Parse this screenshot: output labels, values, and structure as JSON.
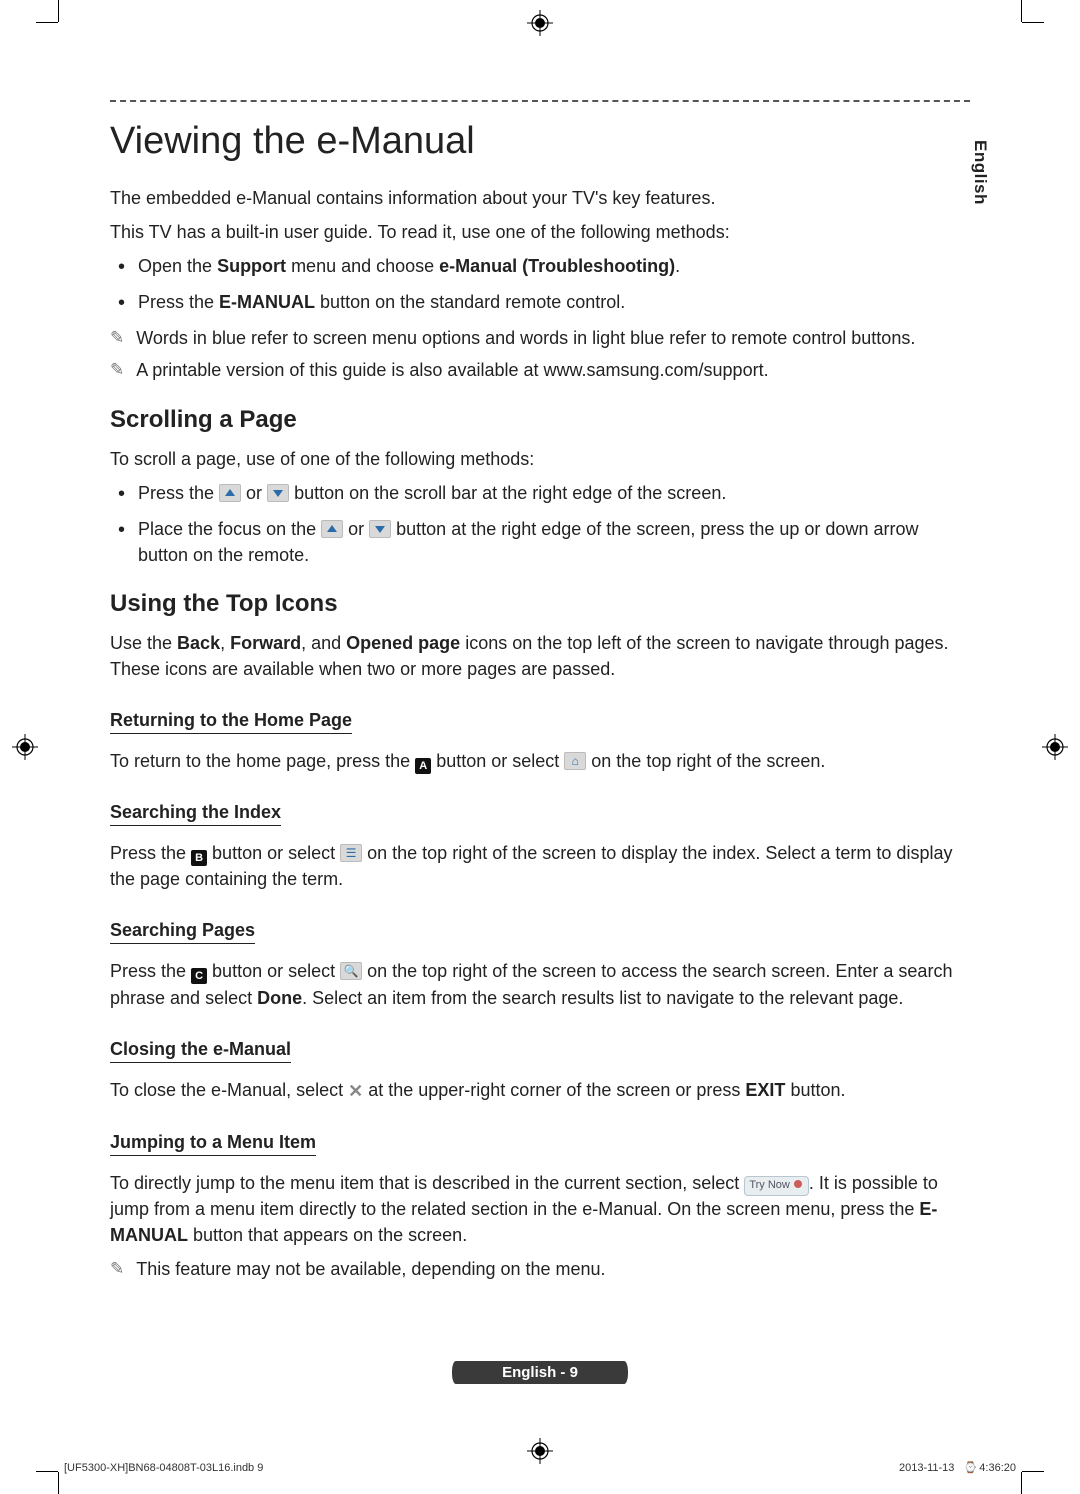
{
  "sideTab": "English",
  "title": "Viewing the e-Manual",
  "intro": {
    "p1": "The embedded e-Manual contains information about your TV's key features.",
    "p2": "This TV has a built-in user guide. To read it, use one of the following methods:",
    "bul1_pre": "Open the ",
    "bul1_b1": "Support",
    "bul1_mid": " menu and choose ",
    "bul1_b2": "e-Manual (Troubleshooting)",
    "bul1_post": ".",
    "bul2_pre": "Press the ",
    "bul2_b": "E-MANUAL",
    "bul2_post": " button on the standard remote control.",
    "note1": "Words in blue refer to screen menu options and words in light blue refer to remote control buttons.",
    "note2": "A printable version of this guide is also available at www.samsung.com/support."
  },
  "scroll": {
    "h": "Scrolling a Page",
    "p": "To scroll a page, use of one of the following methods:",
    "b1_a": "Press the ",
    "b1_b": " or ",
    "b1_c": " button on the scroll bar at the right edge of the screen.",
    "b2_a": "Place the focus on the ",
    "b2_b": " or ",
    "b2_c": " button at the right edge of the screen, press the up or down arrow button on the remote."
  },
  "topicons": {
    "h": "Using the Top Icons",
    "p_a": "Use the ",
    "p_b1": "Back",
    "p_m1": ", ",
    "p_b2": "Forward",
    "p_m2": ", and ",
    "p_b3": "Opened page",
    "p_c": " icons on the top left of the screen to navigate through pages. These icons are available when two or more pages are passed.",
    "home_h": "Returning to the Home Page",
    "home_a": "To return to the home page, press the ",
    "home_b": " button or select ",
    "home_c": " on the top right of the screen.",
    "btnA": "A",
    "index_h": "Searching the Index",
    "index_a": "Press the ",
    "index_b": " button or select ",
    "index_c": " on the top right of the screen to display the index. Select a term to display the page containing the term.",
    "btnB": "B",
    "pages_h": "Searching Pages",
    "pages_a": "Press the ",
    "pages_b": " button or select ",
    "pages_c": " on the top right of the screen to access the search screen. Enter a search phrase and select ",
    "pages_d": "Done",
    "pages_e": ". Select an item from the search results list to navigate to the relevant page.",
    "btnC": "C",
    "close_h": "Closing the e-Manual",
    "close_a": "To close the e-Manual, select ",
    "close_b": " at the upper-right corner of the screen or press ",
    "close_c": "EXIT",
    "close_d": " button.",
    "jump_h": "Jumping to a Menu Item",
    "jump_a": "To directly jump to the menu item that is described in the current section, select ",
    "try_now": "Try Now",
    "jump_b": ". It is possible to jump from a menu item directly to the related section in the e-Manual. On the screen menu, press the ",
    "jump_c": "E-MANUAL",
    "jump_d": " button that appears on the screen.",
    "jump_note": "This feature may not be available, depending on the menu."
  },
  "footer": {
    "label": "English - 9",
    "left": "[UF5300-XH]BN68-04808T-03L16.indb   9",
    "right_date": "2013-11-13",
    "right_time": "4:36:20"
  }
}
